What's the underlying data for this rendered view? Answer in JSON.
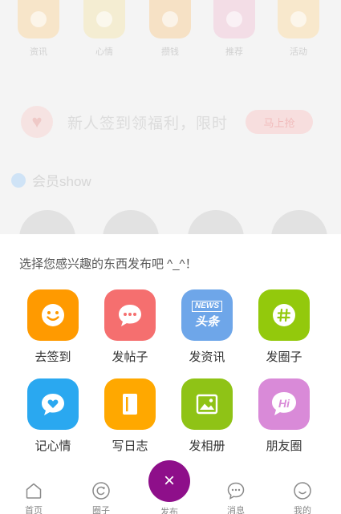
{
  "background": {
    "categories": [
      {
        "label": "资讯",
        "color": "#f7e5c9"
      },
      {
        "label": "心情",
        "color": "#f4edd2"
      },
      {
        "label": "攒钱",
        "color": "#f6e1c5"
      },
      {
        "label": "推荐",
        "color": "#f3dde6"
      },
      {
        "label": "活动",
        "color": "#f8e8cc"
      }
    ],
    "promo_text": "新人签到领福利，限时",
    "promo_button": "马上抢",
    "member_title": "会员show"
  },
  "sheet": {
    "title": "选择您感兴趣的东西发布吧 ^_^！",
    "options": [
      {
        "label": "去签到",
        "icon": "smile-icon",
        "color": "#ff9a00"
      },
      {
        "label": "发帖子",
        "icon": "chat-bubble-icon",
        "color": "#f56f6f"
      },
      {
        "label": "发资讯",
        "icon": "news-icon",
        "color": "#6ea6e9",
        "badge_top": "NEWS",
        "badge_bottom": "头条"
      },
      {
        "label": "发圈子",
        "icon": "hashtag-icon",
        "color": "#93c90c"
      },
      {
        "label": "记心情",
        "icon": "heart-bubble-icon",
        "color": "#2aa8f0"
      },
      {
        "label": "写日志",
        "icon": "notebook-icon",
        "color": "#ffa800"
      },
      {
        "label": "发相册",
        "icon": "photo-icon",
        "color": "#8fc316"
      },
      {
        "label": "朋友圈",
        "icon": "hi-bubble-icon",
        "color": "#d98ad8",
        "badge": "Hi"
      }
    ]
  },
  "tabbar": {
    "tabs": [
      {
        "label": "首页",
        "icon": "home-icon"
      },
      {
        "label": "圈子",
        "icon": "circle-icon"
      },
      {
        "label": "发布",
        "icon": "close-icon"
      },
      {
        "label": "消息",
        "icon": "message-icon"
      },
      {
        "label": "我的",
        "icon": "profile-icon"
      }
    ],
    "center_color": "#8e0f8a",
    "center_glyph": "×"
  }
}
